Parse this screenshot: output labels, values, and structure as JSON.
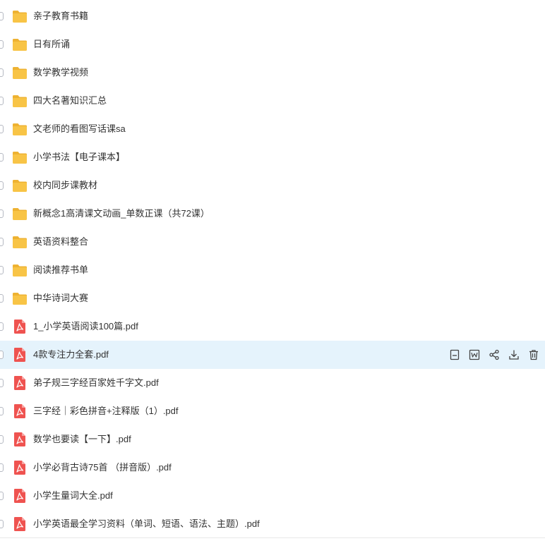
{
  "colors": {
    "folder": "#f8c446",
    "folder_tab": "#eeb232",
    "pdf": "#ef5350",
    "hover_row": "#e5f3fc",
    "text": "#333333"
  },
  "files": [
    {
      "name": "亲子教育书籍",
      "type": "folder"
    },
    {
      "name": "日有所诵",
      "type": "folder"
    },
    {
      "name": "数学教学视频",
      "type": "folder"
    },
    {
      "name": "四大名著知识汇总",
      "type": "folder"
    },
    {
      "name": "文老师的看图写话课sa",
      "type": "folder"
    },
    {
      "name": "小学书法【电子课本】",
      "type": "folder"
    },
    {
      "name": "校内同步课教材",
      "type": "folder"
    },
    {
      "name": "新概念1高清课文动画_单数正课（共72课）",
      "type": "folder"
    },
    {
      "name": "英语资料整合",
      "type": "folder"
    },
    {
      "name": "阅读推荐书单",
      "type": "folder"
    },
    {
      "name": "中华诗词大赛",
      "type": "folder"
    },
    {
      "name": "1_小学英语阅读100篇.pdf",
      "type": "pdf"
    },
    {
      "name": "4款专注力全套.pdf",
      "type": "pdf",
      "hovered": true
    },
    {
      "name": "弟子规三字经百家姓千字文.pdf",
      "type": "pdf"
    },
    {
      "name": "三字经｜彩色拼音+注释版（1）.pdf",
      "type": "pdf"
    },
    {
      "name": "数学也要读【一下】.pdf",
      "type": "pdf"
    },
    {
      "name": "小学必背古诗75首 （拼音版）.pdf",
      "type": "pdf"
    },
    {
      "name": "小学生量词大全.pdf",
      "type": "pdf"
    },
    {
      "name": "小学英语最全学习资料（单词、短语、语法、主题）.pdf",
      "type": "pdf"
    }
  ],
  "row_actions": [
    {
      "icon": "preview-icon",
      "name": "preview-button"
    },
    {
      "icon": "word-convert-icon",
      "name": "convert-word-button"
    },
    {
      "icon": "share-icon",
      "name": "share-button"
    },
    {
      "icon": "download-icon",
      "name": "download-button"
    },
    {
      "icon": "trash-icon",
      "name": "delete-button"
    }
  ]
}
